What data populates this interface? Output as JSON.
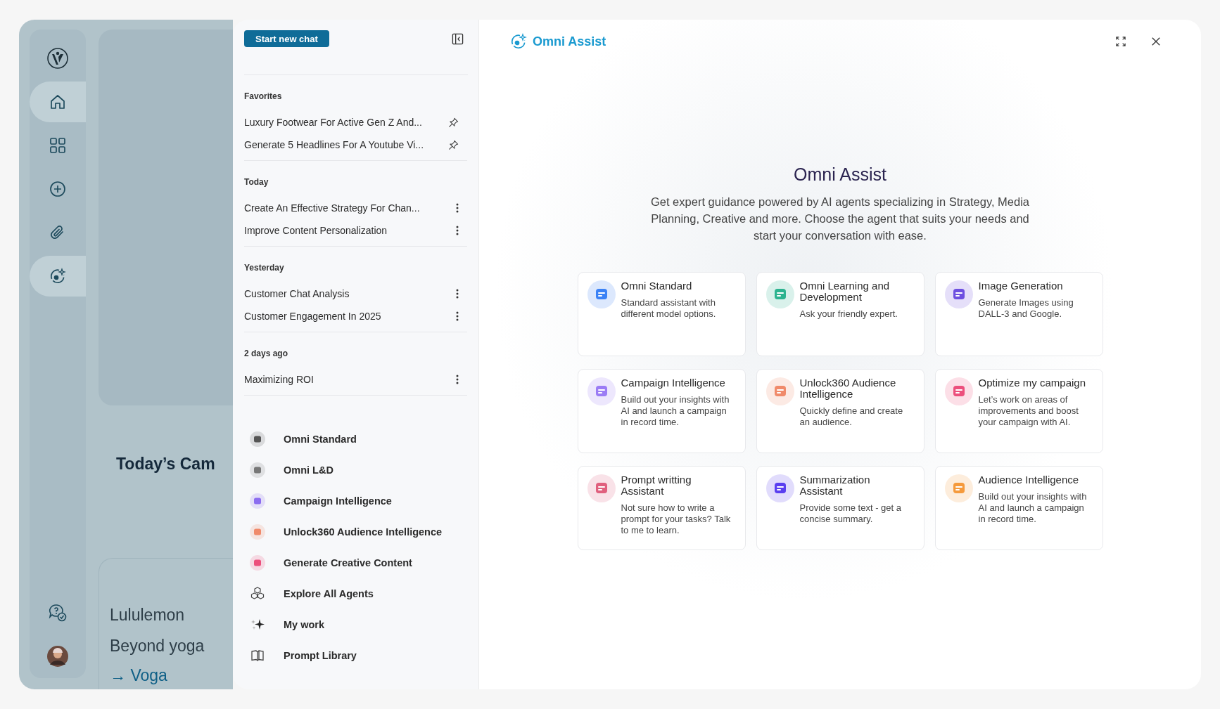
{
  "rail": [
    {
      "kind": "logo",
      "selected": false
    },
    {
      "kind": "home",
      "selected": true
    },
    {
      "kind": "grid",
      "selected": false
    },
    {
      "kind": "plus",
      "selected": false
    },
    {
      "kind": "clip",
      "selected": false
    },
    {
      "kind": "assist",
      "selected": true
    }
  ],
  "rail_bottom": [
    {
      "kind": "help"
    },
    {
      "kind": "avatar"
    }
  ],
  "background_page": {
    "heading": "Today’s Cam",
    "card_lines": [
      "Lululemon",
      "Beyond yoga"
    ],
    "link": {
      "arrow": "→",
      "label": "Voga"
    }
  },
  "chat_panel": {
    "new_chat_button": "Start new chat",
    "sections": [
      {
        "title": "Favorites",
        "items": [
          {
            "label": "Luxury Footwear For Active Gen Z And...",
            "pinned": true
          },
          {
            "label": "Generate 5 Headlines For A Youtube Vi...",
            "pinned": true
          }
        ]
      },
      {
        "title": "Today",
        "items": [
          {
            "label": "Create An Effective Strategy For Chan...",
            "pinned": false
          },
          {
            "label": "Improve Content Personalization",
            "pinned": false
          }
        ]
      },
      {
        "title": "Yesterday",
        "items": [
          {
            "label": "Customer Chat Analysis",
            "pinned": false
          },
          {
            "label": "Customer Engagement In 2025",
            "pinned": false
          }
        ]
      },
      {
        "title": "2 days ago",
        "items": [
          {
            "label": "Maximizing ROI",
            "pinned": false
          }
        ]
      }
    ],
    "agents": [
      {
        "label": "Omni Standard",
        "kind": "agent",
        "color": "#555555"
      },
      {
        "label": "Omni L&D",
        "kind": "agent",
        "color": "#777777"
      },
      {
        "label": "Campaign Intelligence",
        "kind": "agent",
        "color": "#8b6cf0"
      },
      {
        "label": "Unlock360 Audience Intelligence",
        "kind": "agent",
        "color": "#f08a6a"
      },
      {
        "label": "Generate Creative Content",
        "kind": "agent",
        "color": "#ec4f7c"
      },
      {
        "label": "Explore All Agents",
        "kind": "cubes"
      },
      {
        "label": "My work",
        "kind": "sparkle"
      },
      {
        "label": "Prompt Library",
        "kind": "book"
      }
    ]
  },
  "main": {
    "header_title": "Omni Assist",
    "title": "Omni Assist",
    "description": "Get expert guidance powered by AI agents specializing in Strategy, Media Planning, Creative and more. Choose the agent that suits your needs and start your conversation with ease.",
    "cards": [
      {
        "title": "Omni Standard",
        "description": "Standard assistant with different model options.",
        "color": "#3b82f6"
      },
      {
        "title": "Omni Learning and Development",
        "description": "Ask your friendly expert.",
        "color": "#2bb38f"
      },
      {
        "title": "Image Generation",
        "description": "Generate Images using DALL-3 and Google.",
        "color": "#6d4fe0"
      },
      {
        "title": "Campaign Intelligence",
        "description": "Build out your insights with AI and launch a campaign in record time.",
        "color": "#9b7cf5"
      },
      {
        "title": "Unlock360 Audience Intelligence",
        "description": "Quickly define and create an audience.",
        "color": "#f08a6a"
      },
      {
        "title": "Optimize my campaign",
        "description": "Let’s work on areas of improvements and boost your campaign with AI.",
        "color": "#ec4f7c"
      },
      {
        "title": "Prompt writting Assistant",
        "description": "Not sure how to write a prompt for your tasks? Talk to me to learn.",
        "color": "#e0607e"
      },
      {
        "title": "Summarization Assistant",
        "description": "Provide some text - get a concise summary.",
        "color": "#5a3ff0"
      },
      {
        "title": "Audience Intelligence",
        "description": "Build out your insights with AI and launch a campaign in record time.",
        "color": "#f59a3c"
      }
    ]
  }
}
